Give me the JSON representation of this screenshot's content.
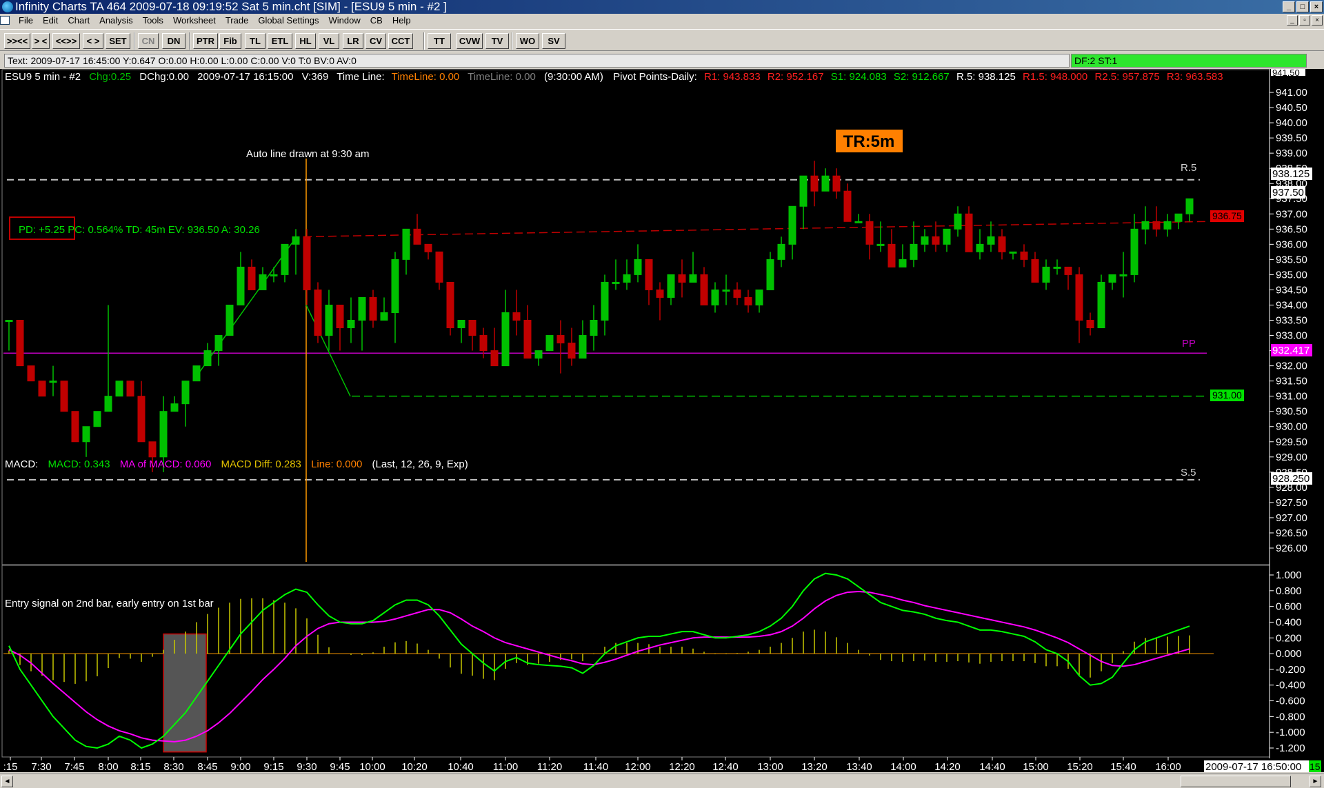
{
  "window": {
    "title": "Infinity Charts TA 464  2009-07-18  09:19:52  Sat   5 min.cht [SIM] - [ESU9  5 min  - #2 ]"
  },
  "menu": [
    "File",
    "Edit",
    "Chart",
    "Analysis",
    "Tools",
    "Worksheet",
    "Trade",
    "Global Settings",
    "Window",
    "CB",
    "Help"
  ],
  "toolbar": {
    "buttons": [
      ">><<",
      "> <",
      "<<>>",
      "< >",
      "SET",
      "CN",
      "DN",
      "PTR",
      "Fib",
      "TL",
      "ETL",
      "HL",
      "VL",
      "LR",
      "CV",
      "CCT",
      "TT",
      "CVW",
      "TV",
      "WO",
      "SV"
    ]
  },
  "status": {
    "text": "Text: 2009-07-17  16:45:00  Y:0.647  O:0.00  H:0.00  L:0.00  C:0.00  V:0  T:0  BV:0  AV:0",
    "df": "DF:2  ST:1"
  },
  "chart_header": {
    "symbol": "ESU9  5 min  - #2",
    "chg": "Chg:0.25",
    "dchg": "DChg:0.00",
    "datetime": "2009-07-17  16:15:00",
    "volume": "V:369",
    "timeline_label": "Time Line:",
    "timeline1": "TimeLine: 0.00",
    "timeline2": "TimeLine: 0.00",
    "timeline_time": "(9:30:00 AM)",
    "pivot_label": "Pivot Points-Daily:",
    "r1": "R1: 943.833",
    "r2": "R2: 952.167",
    "s1": "S1: 924.083",
    "s2": "S2: 912.667",
    "r5": "R.5: 938.125",
    "r15": "R1.5: 948.000",
    "r25": "R2.5: 957.875",
    "r3": "R3: 963.583"
  },
  "annotations": {
    "autoline": "Auto line drawn at 9:30 am",
    "tr": "TR:5m",
    "pd": "PD: +5.25  PC: 0.564%  TD: 45m  EV: 936.50  A: 30.26",
    "r5_label": "R.5",
    "pp_label": "PP",
    "s5_label": "S.5",
    "entry_signal": "Entry signal on 2nd bar, early entry on 1st bar",
    "tag_93675": "936.75",
    "tag_93100": "931.00",
    "tag_r5": "938.125",
    "tag_last": "937.50",
    "tag_pp": "932.417",
    "tag_s5": "928.250",
    "top_price": "941.50"
  },
  "macd_header": {
    "label": "MACD:",
    "macd": "MACD: 0.343",
    "ma": "MA of MACD: 0.060",
    "diff": "MACD Diff: 0.283",
    "line": "Line: 0.000",
    "params": "(Last, 12, 26, 9, Exp)"
  },
  "price_axis": [
    "941.00",
    "940.50",
    "940.00",
    "939.50",
    "939.00",
    "938.50",
    "938.00",
    "937.50",
    "937.00",
    "936.50",
    "936.00",
    "935.50",
    "935.00",
    "934.50",
    "934.00",
    "933.50",
    "933.00",
    "932.50",
    "932.00",
    "931.50",
    "931.00",
    "930.50",
    "930.00",
    "929.50",
    "929.00",
    "928.50",
    "928.00",
    "927.50",
    "927.00",
    "926.50",
    "926.00"
  ],
  "macd_axis": [
    "1.000",
    "0.800",
    "0.600",
    "0.400",
    "0.200",
    "0.000",
    "-0.200",
    "-0.400",
    "-0.600",
    "-0.800",
    "-1.000",
    "-1.200"
  ],
  "time_axis": [
    ":15",
    "7:30",
    "7:45",
    "8:00",
    "8:15",
    "8:30",
    "8:45",
    "9:00",
    "9:15",
    "9:30",
    "9:45",
    "10:00",
    "10:20",
    "10:40",
    "11:00",
    "11:20",
    "11:40",
    "12:00",
    "12:20",
    "12:40",
    "13:00",
    "13:20",
    "13:40",
    "14:00",
    "14:20",
    "14:40",
    "15:00",
    "15:20",
    "15:40",
    "16:00"
  ],
  "time_end": "2009-07-17  16:50:00",
  "time_end_badge": "15",
  "colors": {
    "up": "#00c000",
    "down": "#c00000",
    "macd": "#00ff00",
    "ma": "#ff00ff",
    "pp": "#c000c0",
    "timeline": "#ff9900",
    "hist": "#c8c800",
    "tr_bg": "#ff8000"
  },
  "chart_data": {
    "type": "candlestick",
    "ohlc": [
      [
        933.5,
        933.5,
        932.5,
        933.5
      ],
      [
        933.5,
        933.5,
        932.0,
        932.0
      ],
      [
        932.0,
        932.0,
        931.5,
        931.5
      ],
      [
        931.5,
        931.5,
        931.0,
        931.0
      ],
      [
        931.5,
        932.0,
        931.0,
        931.5
      ],
      [
        931.5,
        931.5,
        930.5,
        930.5
      ],
      [
        930.5,
        930.5,
        929.5,
        929.5
      ],
      [
        929.5,
        930.0,
        929.0,
        930.0
      ],
      [
        930.0,
        930.5,
        930.0,
        930.5
      ],
      [
        930.5,
        934.0,
        930.5,
        931.0
      ],
      [
        931.0,
        931.5,
        931.0,
        931.5
      ],
      [
        931.5,
        931.5,
        931.0,
        931.0
      ],
      [
        931.0,
        931.5,
        929.5,
        929.5
      ],
      [
        929.5,
        929.5,
        928.5,
        929.0
      ],
      [
        929.0,
        931.0,
        928.5,
        930.5
      ],
      [
        930.5,
        931.0,
        930.5,
        930.75
      ],
      [
        930.75,
        931.5,
        930.0,
        931.5
      ],
      [
        931.5,
        932.0,
        931.5,
        932.0
      ],
      [
        932.0,
        932.75,
        932.0,
        932.5
      ],
      [
        932.5,
        933.0,
        932.0,
        933.0
      ],
      [
        933.0,
        934.0,
        933.0,
        934.0
      ],
      [
        934.0,
        935.75,
        934.0,
        935.25
      ],
      [
        935.25,
        935.5,
        934.5,
        934.5
      ],
      [
        934.5,
        935.25,
        934.5,
        935.0
      ],
      [
        935.0,
        935.25,
        934.75,
        935.0
      ],
      [
        935.0,
        936.0,
        934.75,
        936.0
      ],
      [
        936.0,
        936.5,
        935.0,
        936.25
      ],
      [
        936.25,
        936.5,
        934.0,
        934.5
      ],
      [
        934.5,
        934.75,
        932.75,
        933.0
      ],
      [
        933.0,
        934.5,
        932.5,
        934.0
      ],
      [
        934.0,
        934.0,
        932.5,
        933.25
      ],
      [
        933.25,
        934.25,
        932.75,
        933.5
      ],
      [
        933.5,
        934.25,
        932.5,
        934.25
      ],
      [
        934.25,
        934.5,
        933.25,
        933.5
      ],
      [
        933.5,
        934.25,
        933.5,
        933.75
      ],
      [
        933.75,
        935.75,
        932.75,
        935.5
      ],
      [
        935.5,
        936.5,
        935.0,
        936.5
      ],
      [
        936.5,
        937.0,
        936.0,
        936.0
      ],
      [
        936.0,
        936.0,
        935.5,
        935.75
      ],
      [
        935.75,
        935.75,
        934.5,
        934.75
      ],
      [
        934.75,
        934.75,
        933.0,
        933.25
      ],
      [
        933.25,
        933.5,
        932.75,
        933.5
      ],
      [
        933.5,
        933.5,
        932.5,
        933.0
      ],
      [
        933.0,
        933.25,
        932.25,
        932.5
      ],
      [
        932.5,
        933.25,
        932.0,
        932.0
      ],
      [
        932.0,
        934.5,
        932.0,
        933.75
      ],
      [
        933.75,
        934.5,
        933.0,
        933.5
      ],
      [
        933.5,
        934.0,
        932.25,
        932.25
      ],
      [
        932.25,
        932.5,
        932.0,
        932.5
      ],
      [
        932.5,
        933.0,
        932.5,
        933.0
      ],
      [
        933.0,
        933.5,
        931.75,
        932.75
      ],
      [
        932.75,
        933.25,
        932.0,
        932.25
      ],
      [
        932.25,
        933.5,
        932.25,
        933.0
      ],
      [
        933.0,
        934.0,
        932.5,
        933.5
      ],
      [
        933.5,
        935.0,
        933.0,
        934.75
      ],
      [
        934.75,
        935.5,
        934.5,
        934.75
      ],
      [
        934.75,
        935.5,
        934.5,
        935.0
      ],
      [
        935.0,
        936.0,
        934.75,
        935.5
      ],
      [
        935.5,
        935.5,
        934.0,
        934.5
      ],
      [
        934.5,
        934.75,
        933.5,
        934.25
      ],
      [
        934.25,
        935.0,
        934.0,
        935.0
      ],
      [
        935.0,
        935.5,
        934.25,
        934.75
      ],
      [
        934.75,
        935.75,
        934.75,
        935.0
      ],
      [
        935.0,
        935.25,
        934.0,
        934.0
      ],
      [
        934.0,
        934.75,
        933.75,
        934.5
      ],
      [
        934.5,
        935.0,
        934.0,
        934.5
      ],
      [
        934.5,
        934.75,
        934.0,
        934.25
      ],
      [
        934.25,
        934.5,
        933.75,
        934.0
      ],
      [
        934.0,
        934.5,
        933.75,
        934.5
      ],
      [
        934.5,
        935.75,
        934.5,
        935.5
      ],
      [
        935.5,
        936.25,
        935.25,
        936.0
      ],
      [
        936.0,
        937.25,
        935.5,
        937.25
      ],
      [
        937.25,
        938.25,
        936.5,
        938.25
      ],
      [
        938.25,
        938.75,
        937.25,
        937.75
      ],
      [
        937.75,
        938.5,
        937.75,
        938.25
      ],
      [
        938.25,
        938.5,
        937.5,
        937.75
      ],
      [
        937.75,
        938.0,
        937.25,
        936.75
      ],
      [
        936.75,
        937.0,
        936.75,
        936.75
      ],
      [
        936.75,
        937.0,
        935.5,
        936.0
      ],
      [
        936.0,
        936.75,
        935.75,
        936.0
      ],
      [
        936.0,
        936.5,
        935.25,
        935.25
      ],
      [
        935.25,
        936.0,
        935.5,
        935.5
      ],
      [
        935.5,
        936.75,
        935.25,
        936.0
      ],
      [
        936.0,
        936.5,
        935.75,
        936.25
      ],
      [
        936.25,
        936.75,
        935.75,
        936.0
      ],
      [
        936.0,
        936.25,
        935.75,
        936.5
      ],
      [
        936.5,
        937.25,
        936.25,
        937.0
      ],
      [
        937.0,
        937.25,
        936.0,
        935.75
      ],
      [
        935.75,
        936.5,
        935.5,
        936.0
      ],
      [
        936.0,
        936.75,
        935.75,
        936.25
      ],
      [
        936.25,
        936.5,
        935.5,
        935.75
      ],
      [
        935.75,
        935.75,
        935.5,
        935.75
      ],
      [
        935.75,
        936.0,
        935.25,
        935.5
      ],
      [
        935.5,
        935.75,
        935.0,
        934.75
      ],
      [
        934.75,
        935.5,
        934.5,
        935.25
      ],
      [
        935.25,
        935.5,
        935.0,
        935.25
      ],
      [
        935.25,
        935.25,
        934.5,
        935.0
      ],
      [
        935.0,
        935.25,
        932.75,
        933.5
      ],
      [
        933.5,
        933.75,
        933.0,
        933.25
      ],
      [
        933.25,
        935.0,
        933.25,
        934.75
      ],
      [
        934.75,
        935.0,
        934.5,
        935.0
      ],
      [
        935.0,
        935.75,
        934.25,
        935.0
      ],
      [
        935.0,
        937.0,
        934.75,
        936.5
      ],
      [
        936.5,
        937.25,
        936.0,
        936.75
      ],
      [
        936.75,
        937.25,
        936.25,
        936.5
      ],
      [
        936.5,
        937.0,
        936.25,
        936.75
      ],
      [
        936.75,
        937.0,
        936.5,
        937.0
      ],
      [
        937.0,
        937.5,
        936.75,
        937.5
      ]
    ],
    "price_range": [
      926.0,
      941.5
    ],
    "macd": [
      0.1,
      -0.2,
      -0.4,
      -0.6,
      -0.8,
      -0.95,
      -1.1,
      -1.18,
      -1.2,
      -1.15,
      -1.05,
      -1.1,
      -1.2,
      -1.15,
      -1.05,
      -0.9,
      -0.75,
      -0.55,
      -0.35,
      -0.15,
      0.05,
      0.25,
      0.4,
      0.55,
      0.65,
      0.75,
      0.82,
      0.78,
      0.62,
      0.48,
      0.4,
      0.38,
      0.38,
      0.42,
      0.52,
      0.62,
      0.68,
      0.68,
      0.62,
      0.48,
      0.3,
      0.12,
      0.0,
      -0.12,
      -0.22,
      -0.1,
      -0.05,
      -0.12,
      -0.14,
      -0.15,
      -0.16,
      -0.18,
      -0.25,
      -0.15,
      0.0,
      0.1,
      0.15,
      0.2,
      0.22,
      0.22,
      0.25,
      0.28,
      0.28,
      0.24,
      0.2,
      0.2,
      0.22,
      0.24,
      0.28,
      0.35,
      0.45,
      0.6,
      0.8,
      0.95,
      1.02,
      1.0,
      0.95,
      0.85,
      0.75,
      0.65,
      0.6,
      0.55,
      0.53,
      0.5,
      0.45,
      0.42,
      0.4,
      0.35,
      0.3,
      0.3,
      0.28,
      0.25,
      0.22,
      0.15,
      0.05,
      0.0,
      -0.1,
      -0.28,
      -0.4,
      -0.38,
      -0.3,
      -0.12,
      0.05,
      0.15,
      0.2,
      0.25,
      0.3,
      0.35
    ],
    "macd_ma": [
      0.05,
      -0.02,
      -0.12,
      -0.25,
      -0.38,
      -0.5,
      -0.62,
      -0.74,
      -0.84,
      -0.92,
      -0.98,
      -1.02,
      -1.07,
      -1.1,
      -1.11,
      -1.12,
      -1.1,
      -1.05,
      -0.98,
      -0.88,
      -0.76,
      -0.62,
      -0.48,
      -0.33,
      -0.2,
      -0.06,
      0.1,
      0.22,
      0.32,
      0.38,
      0.4,
      0.4,
      0.4,
      0.4,
      0.41,
      0.44,
      0.48,
      0.52,
      0.56,
      0.56,
      0.52,
      0.44,
      0.35,
      0.28,
      0.2,
      0.14,
      0.1,
      0.06,
      0.02,
      -0.02,
      -0.06,
      -0.09,
      -0.13,
      -0.14,
      -0.11,
      -0.07,
      -0.02,
      0.03,
      0.07,
      0.11,
      0.14,
      0.17,
      0.2,
      0.21,
      0.21,
      0.21,
      0.21,
      0.21,
      0.22,
      0.24,
      0.28,
      0.35,
      0.45,
      0.57,
      0.67,
      0.74,
      0.78,
      0.79,
      0.78,
      0.75,
      0.72,
      0.68,
      0.65,
      0.61,
      0.58,
      0.55,
      0.52,
      0.49,
      0.46,
      0.43,
      0.4,
      0.37,
      0.34,
      0.3,
      0.25,
      0.2,
      0.14,
      0.06,
      -0.02,
      -0.1,
      -0.15,
      -0.16,
      -0.14,
      -0.1,
      -0.06,
      -0.02,
      0.02,
      0.06
    ],
    "macd_range": [
      -1.3,
      1.1
    ]
  }
}
